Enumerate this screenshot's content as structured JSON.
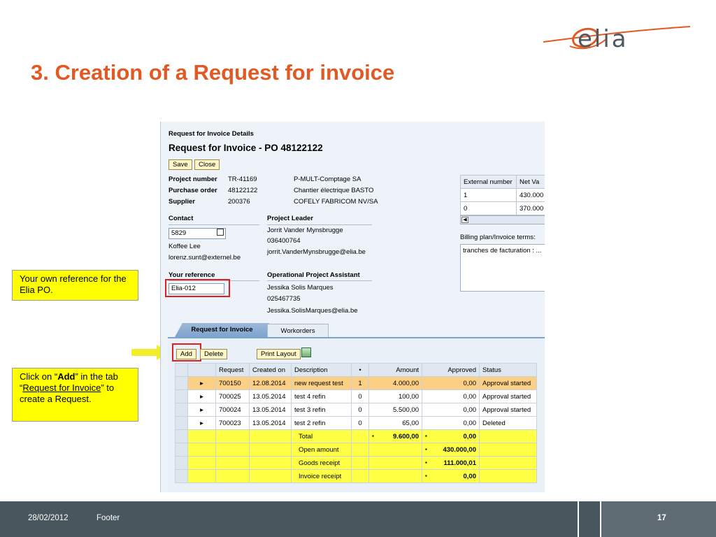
{
  "slide": {
    "title": "3. Creation of a Request for invoice",
    "logo_text": "elia",
    "footer_date": "28/02/2012",
    "footer_label": "Footer",
    "page_number": "17",
    "accent_color": "#e15a24"
  },
  "callouts": {
    "reference": "Your own reference for the Elia PO.",
    "add_prefix": "Click on “",
    "add_bold": "Add",
    "add_mid": "” in the tab “",
    "add_link": "Request for Invoice",
    "add_suffix": "” to create a Request."
  },
  "screen": {
    "breadcrumb": "Request for Invoice Details",
    "heading": "Request for Invoice - PO 48122122",
    "save_label": "Save",
    "close_label": "Close",
    "info": {
      "project_number_label": "Project number",
      "project_number": "TR-41169",
      "project_name": "P-MULT-Comptage SA",
      "purchase_order_label": "Purchase order",
      "purchase_order": "48122122",
      "purchase_order_desc": "Chantier électrique BASTO",
      "supplier_label": "Supplier",
      "supplier": "200376",
      "supplier_name": "COFELY FABRICOM NV/SA"
    },
    "contact": {
      "label": "Contact",
      "id": "5829",
      "name": "Koffee Lee",
      "email": "lorenz.sunt@externel.be"
    },
    "project_leader": {
      "label": "Project Leader",
      "name": "Jorrit Vander Mynsbrugge",
      "phone": "036400764",
      "email": "jorrit.VanderMynsbrugge@elia.be"
    },
    "your_reference": {
      "label": "Your reference",
      "value": "Elia-012"
    },
    "assistant": {
      "label": "Operational Project Assistant",
      "name": "Jessika Solis Marques",
      "phone": "025467735",
      "email": "Jessika.SolisMarques@elia.be"
    },
    "external_table": {
      "headers": [
        "External number",
        "Net Va"
      ],
      "rows": [
        [
          "1",
          "430.000"
        ],
        [
          "0",
          "370.000"
        ]
      ]
    },
    "terms": {
      "label": "Billing plan/Invoice terms:",
      "value": "tranches de facturation : ..."
    },
    "tabs": [
      "Request for Invoice",
      "Workorders"
    ],
    "toolbar": {
      "add_label": "Add",
      "delete_label": "Delete",
      "print_label": "Print Layout"
    },
    "grid": {
      "headers": [
        "Request",
        "Created on",
        "Description",
        "Amount",
        "Approved",
        "Status"
      ],
      "rows": [
        {
          "request": "700150",
          "created": "12.08.2014",
          "description": "new request test",
          "attach": "1",
          "amount": "4.000,00",
          "approved": "0,00",
          "status": "Approval started"
        },
        {
          "request": "700025",
          "created": "13.05.2014",
          "description": "test 4 refin",
          "attach": "0",
          "amount": "100,00",
          "approved": "0,00",
          "status": "Approval started"
        },
        {
          "request": "700024",
          "created": "13.05.2014",
          "description": "test 3 refin",
          "attach": "0",
          "amount": "5.500,00",
          "approved": "0,00",
          "status": "Approval started"
        },
        {
          "request": "700023",
          "created": "13.05.2014",
          "description": "test 2 refin",
          "attach": "0",
          "amount": "65,00",
          "approved": "0,00",
          "status": "Deleted"
        }
      ],
      "totals": [
        {
          "label": "Total",
          "amount": "9.600,00",
          "approved": "0,00"
        },
        {
          "label": "Open amount",
          "amount": "",
          "approved": "430.000,00"
        },
        {
          "label": "Goods receipt",
          "amount": "",
          "approved": "111.000,01"
        },
        {
          "label": "Invoice receipt",
          "amount": "",
          "approved": "0,00"
        }
      ]
    }
  }
}
